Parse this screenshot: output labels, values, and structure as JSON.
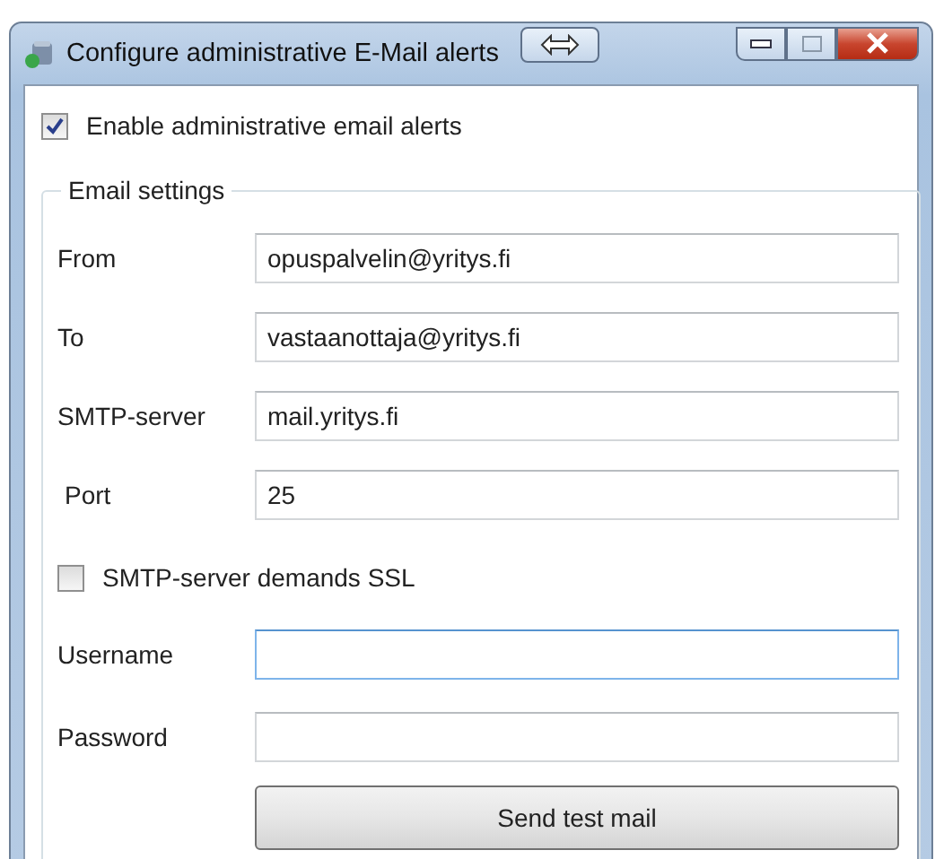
{
  "window": {
    "title": "Configure administrative E-Mail alerts"
  },
  "enable_alerts": {
    "label": "Enable administrative email alerts",
    "checked": true
  },
  "email_settings": {
    "title": "Email settings",
    "fields": [
      {
        "label": "From",
        "value": "opuspalvelin@yritys.fi",
        "focused": false
      },
      {
        "label": "To",
        "value": "vastaanottaja@yritys.fi",
        "focused": false
      },
      {
        "label": "SMTP-server",
        "value": "mail.yritys.fi",
        "focused": false
      },
      {
        "label": "Port",
        "value": "25",
        "focused": false
      }
    ],
    "ssl": {
      "label": "SMTP-server demands SSL",
      "checked": false
    },
    "credentials": [
      {
        "label": "Username",
        "focused": true
      },
      {
        "label": "Password",
        "focused": false
      }
    ],
    "test_button": "Send test mail"
  }
}
